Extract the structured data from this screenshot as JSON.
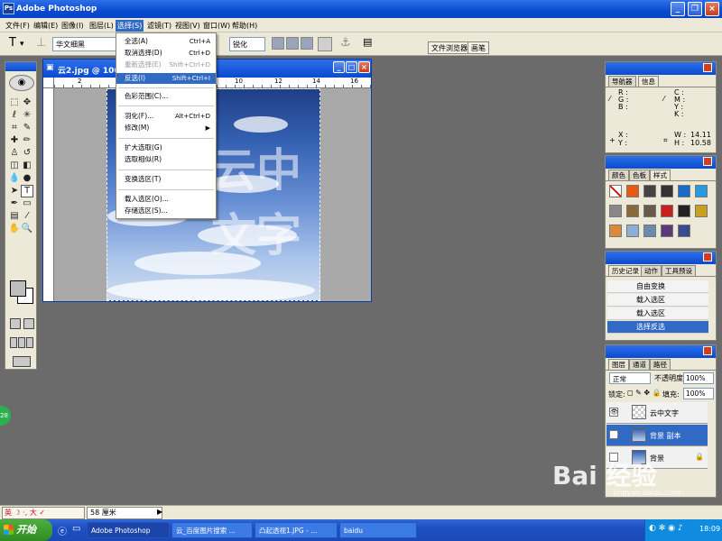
{
  "app": {
    "title": "Adobe Photoshop",
    "icon_label": "Ps"
  },
  "menubar": {
    "items": [
      "文件(F)",
      "编辑(E)",
      "图像(I)",
      "图层(L)",
      "选择(S)",
      "滤镜(T)",
      "视图(V)",
      "窗口(W)",
      "帮助(H)"
    ],
    "active": "选择(S)"
  },
  "options": {
    "font_family": "华文细黑",
    "antialias": "锐化",
    "file_browser_tab": "文件浏览器",
    "brushes_tab": "画笔"
  },
  "select_menu": {
    "items": [
      {
        "label": "全选(A)",
        "shortcut": "Ctrl+A",
        "state": "normal"
      },
      {
        "label": "取消选择(D)",
        "shortcut": "Ctrl+D",
        "state": "normal"
      },
      {
        "label": "重新选择(E)",
        "shortcut": "Shift+Ctrl+D",
        "state": "disabled"
      },
      {
        "label": "反选(I)",
        "shortcut": "Shift+Ctrl+I",
        "state": "highlighted"
      },
      {
        "label": "色彩范围(C)...",
        "shortcut": "",
        "state": "normal"
      },
      {
        "label": "羽化(F)...",
        "shortcut": "Alt+Ctrl+D",
        "state": "normal"
      },
      {
        "label": "修改(M)",
        "shortcut": "▶",
        "state": "normal"
      },
      {
        "label": "扩大选取(G)",
        "shortcut": "",
        "state": "normal"
      },
      {
        "label": "选取相似(R)",
        "shortcut": "",
        "state": "normal"
      },
      {
        "label": "变换选区(T)",
        "shortcut": "",
        "state": "normal"
      },
      {
        "label": "载入选区(O)...",
        "shortcut": "",
        "state": "normal"
      },
      {
        "label": "存储选区(S)...",
        "shortcut": "",
        "state": "normal"
      }
    ]
  },
  "document": {
    "title": "云2.jpg @ 100%",
    "ruler_marks": [
      "2",
      "4",
      "6",
      "8",
      "10",
      "12",
      "14",
      "16"
    ],
    "overlay_text": "云中文字"
  },
  "navigator": {
    "tabs": [
      "导航器",
      "信息"
    ],
    "active_tab": "信息",
    "rgb_labels": [
      "R :",
      "G :",
      "B :"
    ],
    "cmyk_labels": [
      "C :",
      "M :",
      "Y :",
      "K :"
    ],
    "xy_labels": [
      "X :",
      "Y :"
    ],
    "w_label": "W :",
    "h_label": "H :",
    "width": "14.11",
    "height": "10.58"
  },
  "styles": {
    "tabs": [
      "颜色",
      "色板",
      "样式"
    ],
    "active_tab": "样式",
    "colors": [
      "#ffffff",
      "#e85a10",
      "#444",
      "#333",
      "#1a6ac6",
      "#2a9ae0",
      "#888",
      "#8a6a3a",
      "#6a5a4a",
      "#c82020",
      "#222",
      "#c8a020",
      "#d88a40",
      "#8ab0d8",
      "#6a8aa8",
      "#5a3a7a",
      "#3a4a8a"
    ]
  },
  "history": {
    "tabs": [
      "历史记录",
      "动作",
      "工具预设"
    ],
    "active_tab": "历史记录",
    "items": [
      {
        "label": "自由变换",
        "selected": false
      },
      {
        "label": "载入选区",
        "selected": false
      },
      {
        "label": "载入选区",
        "selected": false
      },
      {
        "label": "选择反选",
        "selected": true
      }
    ]
  },
  "layers": {
    "tabs": [
      "图层",
      "通道",
      "路径"
    ],
    "active_tab": "图层",
    "blend_mode": "正常",
    "opacity_label": "不透明度:",
    "opacity": "100%",
    "lock_label": "锁定:",
    "fill_label": "填充:",
    "fill": "100%",
    "items": [
      {
        "name": "云中文字",
        "selected": false
      },
      {
        "name": "背景 副本",
        "selected": true
      },
      {
        "name": "背景",
        "selected": false
      }
    ]
  },
  "statusbar": {
    "ime": "英 ☽ ·, 大 ✓",
    "size": "58 厘米",
    "badge": "28"
  },
  "taskbar": {
    "start": "开始",
    "tasks": [
      "Adobe Photoshop",
      "云_百度图片搜索 ...",
      "凸起透视1.JPG - ...",
      "baidu"
    ],
    "clock": "18:09"
  },
  "watermark": {
    "text": "Bai 经验",
    "url": "jingyan.baidu.com"
  }
}
